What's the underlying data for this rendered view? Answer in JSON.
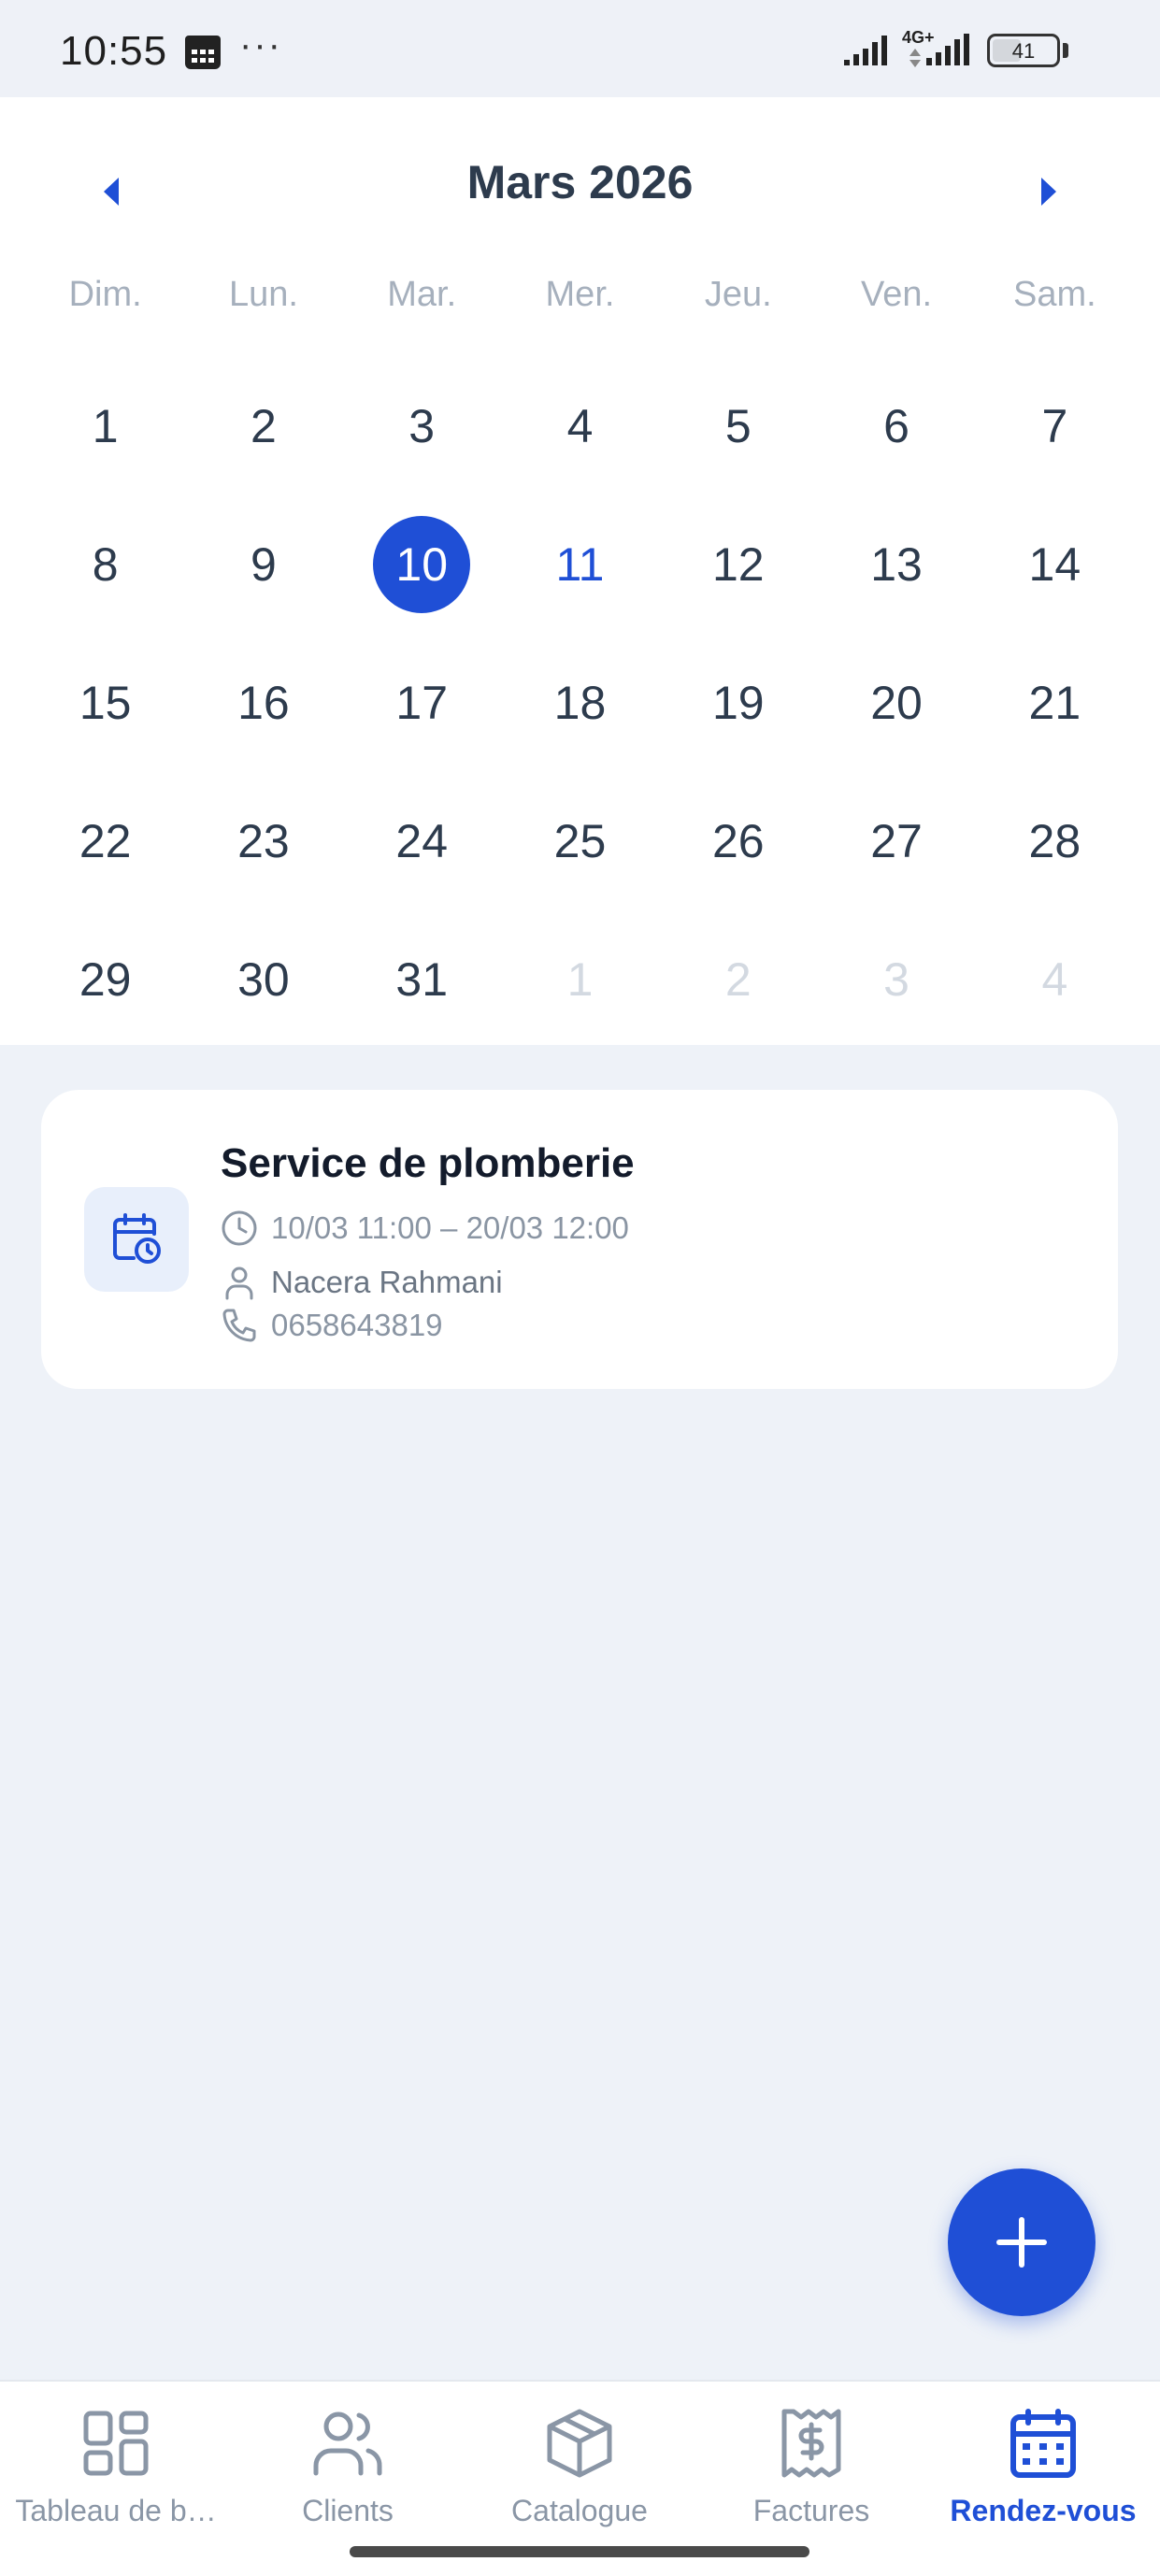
{
  "status_bar": {
    "time": "10:55",
    "dots": "···",
    "network": "4G+",
    "battery": "41"
  },
  "calendar": {
    "month_title": "Mars 2026",
    "prev_icon": "chevron-left-icon",
    "next_icon": "chevron-right-icon",
    "weekdays": [
      "Dim.",
      "Lun.",
      "Mar.",
      "Mer.",
      "Jeu.",
      "Ven.",
      "Sam."
    ],
    "days": [
      {
        "n": "1"
      },
      {
        "n": "2"
      },
      {
        "n": "3"
      },
      {
        "n": "4"
      },
      {
        "n": "5"
      },
      {
        "n": "6"
      },
      {
        "n": "7"
      },
      {
        "n": "8"
      },
      {
        "n": "9"
      },
      {
        "n": "10",
        "state": "selected"
      },
      {
        "n": "11",
        "state": "today"
      },
      {
        "n": "12"
      },
      {
        "n": "13"
      },
      {
        "n": "14"
      },
      {
        "n": "15"
      },
      {
        "n": "16"
      },
      {
        "n": "17"
      },
      {
        "n": "18"
      },
      {
        "n": "19"
      },
      {
        "n": "20"
      },
      {
        "n": "21"
      },
      {
        "n": "22"
      },
      {
        "n": "23"
      },
      {
        "n": "24"
      },
      {
        "n": "25"
      },
      {
        "n": "26"
      },
      {
        "n": "27"
      },
      {
        "n": "28"
      },
      {
        "n": "29"
      },
      {
        "n": "30"
      },
      {
        "n": "31"
      },
      {
        "n": "1",
        "state": "muted"
      },
      {
        "n": "2",
        "state": "muted"
      },
      {
        "n": "3",
        "state": "muted"
      },
      {
        "n": "4",
        "state": "muted"
      }
    ]
  },
  "appointment": {
    "title": "Service de plomberie",
    "time_range": "10/03 11:00 – 20/03 12:00",
    "client": "Nacera Rahmani",
    "phone": "0658643819",
    "icon": "calendar-clock-icon"
  },
  "fab": {
    "icon": "plus-icon"
  },
  "bottom_nav": {
    "items": [
      {
        "label": "Tableau de b…",
        "icon": "dashboard-grid-icon"
      },
      {
        "label": "Clients",
        "icon": "users-icon"
      },
      {
        "label": "Catalogue",
        "icon": "box-icon"
      },
      {
        "label": "Factures",
        "icon": "receipt-dollar-icon"
      },
      {
        "label": "Rendez-vous",
        "icon": "calendar-icon",
        "active": true
      }
    ]
  },
  "colors": {
    "accent": "#1f4fd6",
    "background": "#eef2f8",
    "card": "#ffffff",
    "text_primary": "#2d3b4d",
    "text_muted": "#a6b0bd"
  }
}
